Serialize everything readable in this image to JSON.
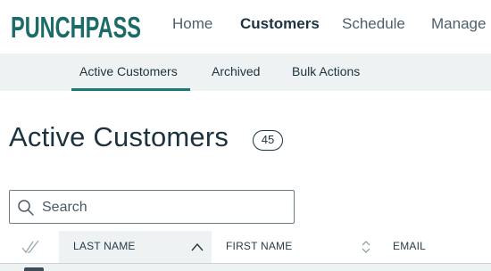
{
  "brand": {
    "logo_text": "PUNCHPASS",
    "color": "#1b6b68"
  },
  "topnav": {
    "items": [
      {
        "label": "Home",
        "active": false
      },
      {
        "label": "Customers",
        "active": true
      },
      {
        "label": "Schedule",
        "active": false
      },
      {
        "label": "Manage",
        "active": false
      }
    ]
  },
  "subnav": {
    "items": [
      {
        "label": "Active Customers",
        "active": true
      },
      {
        "label": "Archived",
        "active": false
      },
      {
        "label": "Bulk Actions",
        "active": false
      }
    ],
    "accent_color": "#1b7a78"
  },
  "page": {
    "title": "Active Customers",
    "count": "45"
  },
  "search": {
    "placeholder": "Search",
    "value": ""
  },
  "table": {
    "columns": [
      {
        "label": "LAST NAME",
        "sort": "ascending"
      },
      {
        "label": "FIRST NAME",
        "sort": "none"
      },
      {
        "label": "EMAIL",
        "sort": "none"
      }
    ]
  }
}
